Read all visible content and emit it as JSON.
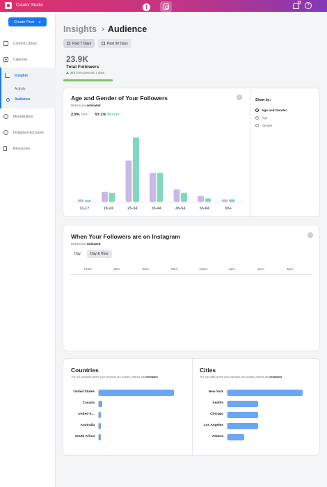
{
  "topbar": {
    "app_name": "Creator Studio",
    "fb_glyph": "f",
    "help_glyph": "?",
    "accent": "#c13584"
  },
  "sidebar": {
    "create_label": "Create Post",
    "items": [
      {
        "label": "Content Library",
        "icon": "library-icon"
      },
      {
        "label": "Calendar",
        "icon": "calendar-icon"
      },
      {
        "label": "Insights",
        "icon": "insights-icon"
      },
      {
        "label": "Activity"
      },
      {
        "label": "Audience"
      },
      {
        "label": "Monetization",
        "icon": "monetization-icon"
      },
      {
        "label": "Instagram Accounts",
        "icon": "account-icon"
      },
      {
        "label": "Resources",
        "icon": "resources-icon"
      }
    ]
  },
  "header": {
    "crumb": "Insights",
    "title": "Audience"
  },
  "range": {
    "opt1": "Past 7 Days",
    "opt2": "Past 30 Days",
    "selected": "Past 7 Days"
  },
  "followers": {
    "count": "23.9K",
    "label": "Total Followers",
    "delta_value": "373",
    "delta_text": "from previous 7 days",
    "progress": 0.28
  },
  "age_gender": {
    "title": "Age and Gender of Your Followers",
    "note_prefix": "Metrics are",
    "note_bold": "estimated",
    "men_pct": "2.9%",
    "men_label": "Men",
    "women_pct": "97.1%",
    "women_label": "Women",
    "info_glyph": "i",
    "showby_title": "Show by:",
    "showby_options": [
      "Age and Gender",
      "Age",
      "Gender"
    ],
    "showby_selected": "Age and Gender"
  },
  "chart_data": {
    "type": "bar",
    "categories": [
      "13-17",
      "18-24",
      "25-34",
      "35-44",
      "45-54",
      "55-64",
      "65+"
    ],
    "series": [
      {
        "name": "Men",
        "color": "#c9b8e8",
        "values": [
          3,
          12,
          50,
          35,
          15,
          7,
          3
        ]
      },
      {
        "name": "Women",
        "color": "#7fd8bf",
        "values": [
          2,
          11,
          78,
          35,
          11,
          4,
          3
        ]
      }
    ],
    "ylim": [
      0,
      80
    ]
  },
  "when": {
    "title": "When Your Followers are on Instagram",
    "note_prefix": "Metrics are",
    "note_bold": "estimated",
    "tab_day": "Day",
    "tab_dayhour": "Day & Hour",
    "hours": [
      "12am",
      "3am",
      "6am",
      "9am",
      "12pm",
      "3pm",
      "6pm",
      "9pm"
    ],
    "info_glyph": "i"
  },
  "countries": {
    "title": "Countries",
    "note_prefix": "The top countries where your followers are located. Metrics are",
    "note_bold": "estimated",
    "rows": [
      {
        "name": "United States",
        "value": 100
      },
      {
        "name": "Canada",
        "value": 5
      },
      {
        "name": "United K...",
        "value": 3
      },
      {
        "name": "Australia",
        "value": 2
      },
      {
        "name": "South Africa",
        "value": 2
      }
    ]
  },
  "cities": {
    "title": "Cities",
    "note_prefix": "The top cities where your followers are located. Metrics are",
    "note_bold": "estimated",
    "rows": [
      {
        "name": "New York",
        "value": 100
      },
      {
        "name": "Seattle",
        "value": 41
      },
      {
        "name": "Chicago",
        "value": 41
      },
      {
        "name": "Los Angeles",
        "value": 41
      },
      {
        "name": "Atlanta",
        "value": 22
      }
    ]
  }
}
